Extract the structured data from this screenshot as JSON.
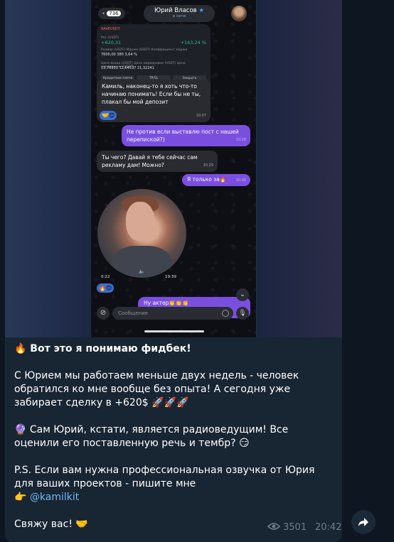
{
  "screenshot": {
    "back_count": "736",
    "chat_name": "Юрий Власов",
    "chat_status": "в сети",
    "card": {
      "symbol": "RAVEUSDT",
      "pnl_label": "PnL (USDT)",
      "pnl_value": "+620,31",
      "pnl_percent": "+163,24 %",
      "r2_label": "Размер (USDT)  Маржа (USDT)  Коэффициент маржи",
      "r2_values": "7600,00        380        3,64 %",
      "r3_label": "Цена входа (USDT)  Цена маркировки (USDT)  Цена ликвидации (USDT)",
      "r3_values": "13,76931        12,64537        21,32241",
      "buttons": [
        "Кредитное плечо",
        "TP/SL",
        "Закрыть"
      ]
    },
    "messages": [
      {
        "text": "Камиль, наконец-то я хоть что-то начинаю понимать! Если бы не ты, плакал бы мой депозит",
        "time": "10:07",
        "dir": "in"
      },
      {
        "text": "Не против если выставлю пост с нашей перепиской?)",
        "time": "10:28",
        "dir": "out"
      },
      {
        "text": "Ты чего? Давай я тебе сейчас сам рекламу дам! Можно?",
        "time": "10:29",
        "dir": "in"
      },
      {
        "text": "Я только за🔥",
        "time": "10:30",
        "dir": "out"
      }
    ],
    "reaction1": "🤝😊",
    "reaction2": "🔥😊",
    "video_elapsed": "0:22",
    "video_time": "19:39",
    "last_message": "Ну актер👏👏👏",
    "composer_placeholder": "Сообщение"
  },
  "post": {
    "line1": "🔥 Вот это я понимаю фидбек!",
    "para2": "С Юрием мы работаем меньше двух недель - человек обратился ко мне вообще без опыта! А сегодня уже забирает сделку в +620$ 🚀🚀🚀",
    "para3": "🔮 Сам Юрий, кстати, является радиоведущим! Все оценили его поставленную речь и тембр? 😏",
    "para4": "P.S. Если вам нужна профессиональная озвучка от Юрия для ваших проектов - пишите мне",
    "mention_prefix": "👉",
    "mention": "@kamilkit",
    "para5": "Свяжу вас! 🤝",
    "views": "3501",
    "time": "20:42"
  },
  "icons": {
    "views": "eye-icon",
    "share": "share-icon"
  },
  "colors": {
    "background": "#0e1621",
    "post_bg": "#182533",
    "link": "#71baf2",
    "meta": "#6d7f8f"
  }
}
